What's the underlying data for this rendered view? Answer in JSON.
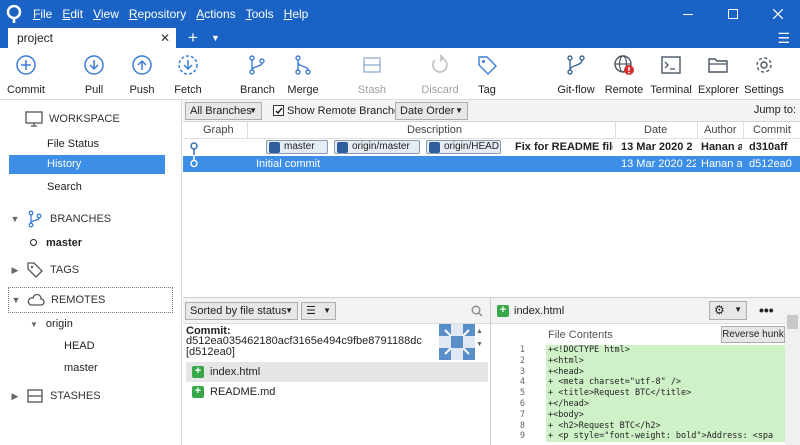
{
  "menu": [
    "File",
    "Edit",
    "View",
    "Repository",
    "Actions",
    "Tools",
    "Help"
  ],
  "tab": {
    "label": "project"
  },
  "toolbar": {
    "commit": "Commit",
    "pull": "Pull",
    "push": "Push",
    "fetch": "Fetch",
    "branch": "Branch",
    "merge": "Merge",
    "stash": "Stash",
    "discard": "Discard",
    "tag": "Tag",
    "gitflow": "Git-flow",
    "remote": "Remote",
    "terminal": "Terminal",
    "explorer": "Explorer",
    "settings": "Settings"
  },
  "sidebar": {
    "workspace": "WORKSPACE",
    "file_status": "File Status",
    "history": "History",
    "search": "Search",
    "branches": "BRANCHES",
    "master": "master",
    "tags": "TAGS",
    "remotes": "REMOTES",
    "origin": "origin",
    "head": "HEAD",
    "origin_master": "master",
    "stashes": "STASHES"
  },
  "filters": {
    "branches": "All Branches",
    "show_remote": "Show Remote Branches",
    "show_remote_checked": true,
    "order": "Date Order",
    "jump": "Jump to:"
  },
  "history": {
    "columns": {
      "graph": "Graph",
      "description": "Description",
      "date": "Date",
      "author": "Author",
      "commit": "Commit"
    },
    "rows": [
      {
        "tags": [
          "master",
          "origin/master",
          "origin/HEAD"
        ],
        "message": "Fix for README file",
        "date": "13 Mar 2020 2",
        "author": "Hanan a",
        "commit": "d310aff"
      },
      {
        "message": "Initial commit",
        "date": "13 Mar 2020 22",
        "author": "Hanan a",
        "commit": "d512ea0"
      }
    ]
  },
  "details": {
    "sort": "Sorted by file status",
    "commit_label": "Commit:",
    "hash_line1": "d512ea035462180acf3165e494c9fbe8791188dc",
    "hash_line2": "[d512ea0]",
    "files": [
      "index.html",
      "README.md"
    ]
  },
  "diff": {
    "file": "index.html",
    "header": "File Contents",
    "reverse_hunk": "Reverse hunk",
    "lines": [
      {
        "n": "1",
        "t": "+<!DOCTYPE html>"
      },
      {
        "n": "2",
        "t": "+<html>"
      },
      {
        "n": "3",
        "t": "+<head>"
      },
      {
        "n": "4",
        "t": "+   <meta charset=\"utf-8\" />"
      },
      {
        "n": "5",
        "t": "+   <title>Request BTC</title>"
      },
      {
        "n": "6",
        "t": "+</head>"
      },
      {
        "n": "7",
        "t": "+<body>"
      },
      {
        "n": "8",
        "t": "+   <h2>Request BTC</h2>"
      },
      {
        "n": "9",
        "t": "+   <p style=\"font-weight: bold\">Address: <spa"
      }
    ]
  },
  "colors": {
    "accent": "#1a63c5",
    "selection": "#3d8ee6",
    "added": "#cff1c8"
  }
}
